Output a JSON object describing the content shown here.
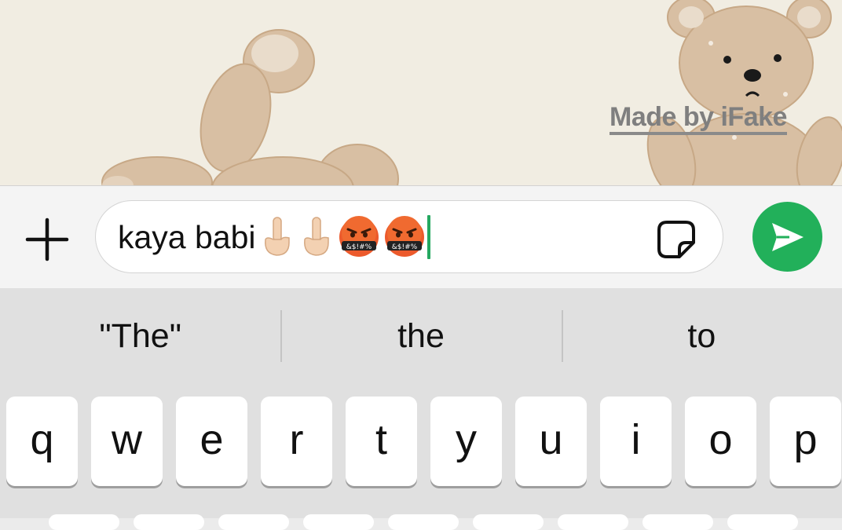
{
  "wallpaper": {
    "watermark": "Made by iFake"
  },
  "input_bar": {
    "add_icon": "plus-icon",
    "message_text": "kaya babi",
    "emojis": [
      "middle-finger-emoji",
      "middle-finger-emoji",
      "cursing-face-emoji",
      "cursing-face-emoji"
    ],
    "sticker_icon": "sticker-icon",
    "send_icon": "send-arrow-icon",
    "colors": {
      "send": "#22b05a",
      "caret": "#25a860"
    }
  },
  "keyboard": {
    "suggestions": [
      "\"The\"",
      "the",
      "to"
    ],
    "top_row": [
      "q",
      "w",
      "e",
      "r",
      "t",
      "y",
      "u",
      "i",
      "o",
      "p"
    ]
  }
}
